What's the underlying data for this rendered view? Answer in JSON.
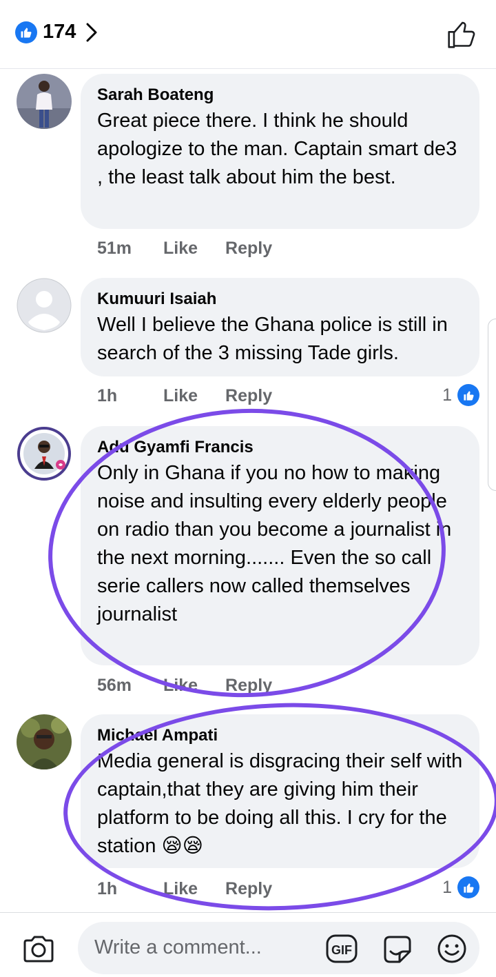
{
  "header": {
    "reaction_count": "174"
  },
  "comments": [
    {
      "author": "Sarah Boateng",
      "text": "Great piece there. I think he should apologize to the man. Captain smart de3 , the least talk about him the best.",
      "time": "51m",
      "like_label": "Like",
      "reply_label": "Reply"
    },
    {
      "author": "Kumuuri Isaiah",
      "text": "Well I believe the Ghana police is still in search of the 3 missing Tade girls.",
      "time": "1h",
      "like_label": "Like",
      "reply_label": "Reply",
      "reactions": "1"
    },
    {
      "author": "Adu Gyamfi Francis",
      "text": "Only in Ghana if you no how to making noise and insulting every elderly people on radio than you become a journalist in the next morning....... Even the so call serie callers now called themselves journalist",
      "time": "56m",
      "like_label": "Like",
      "reply_label": "Reply"
    },
    {
      "author": "Michael Ampati",
      "text": "Media general is disgracing their self with captain,that they are giving him their platform to be doing all this. I cry for the station 😪😪",
      "time": "1h",
      "like_label": "Like",
      "reply_label": "Reply",
      "reactions": "1"
    }
  ],
  "composer": {
    "placeholder": "Write a comment...",
    "gif_label": "GIF"
  },
  "colors": {
    "brand_blue": "#1877f2",
    "bubble_bg": "#f0f2f5",
    "meta_gray": "#65676b",
    "annotation_purple": "#7b4be8"
  },
  "icons": [
    "like-thumb-icon",
    "chevron-right-icon",
    "thumb-up-outline-icon",
    "camera-icon",
    "gif-icon",
    "sticker-icon",
    "emoji-icon"
  ]
}
